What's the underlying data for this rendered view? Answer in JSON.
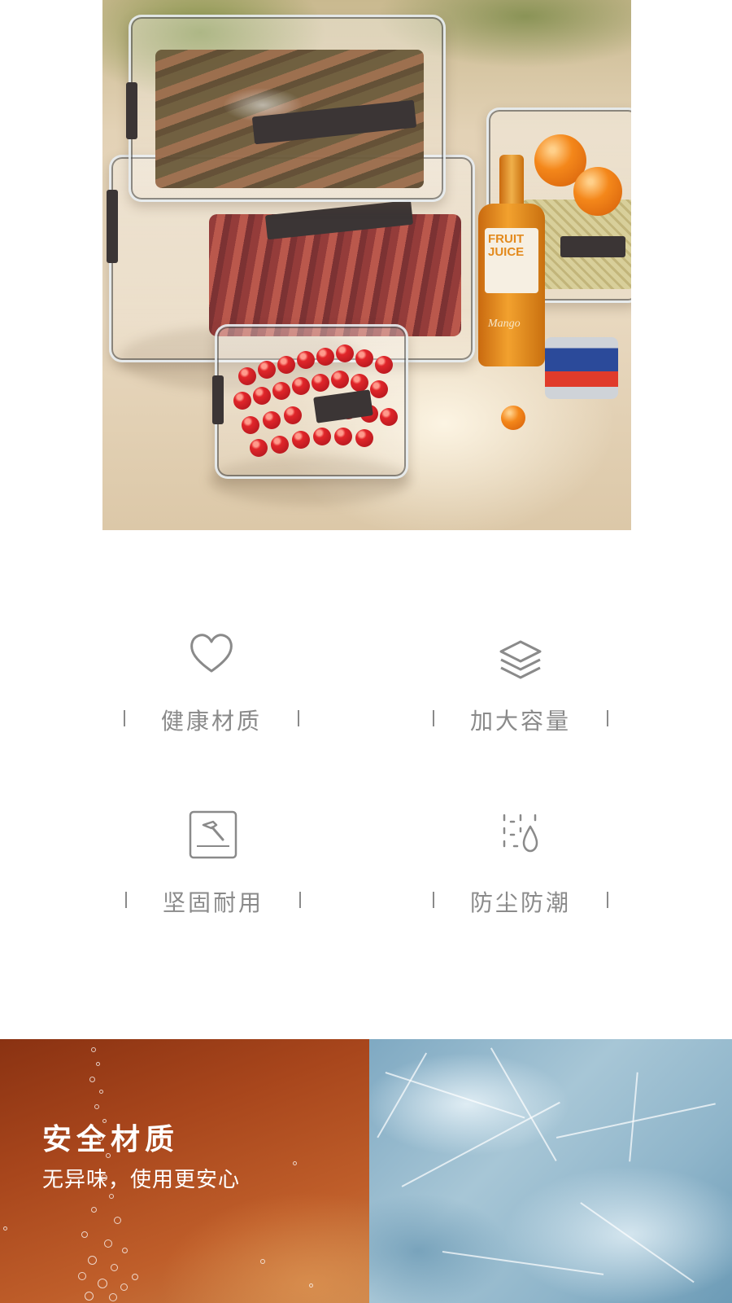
{
  "features": [
    {
      "label": "健康材质",
      "icon": "heart-icon"
    },
    {
      "label": "加大容量",
      "icon": "layers-icon"
    },
    {
      "label": "坚固耐用",
      "icon": "hammer-icon"
    },
    {
      "label": "防尘防潮",
      "icon": "droplet-dust-icon"
    }
  ],
  "hero": {
    "bottle_label": "FRUIT JUICE",
    "bottle_flavor": "Mango"
  },
  "banner": {
    "title": "安全材质",
    "subtitle": "无异味，使用更安心"
  },
  "colors": {
    "feature_text": "#8a8a8a",
    "banner_warm": "#a8461c",
    "banner_ice": "#8fb5ca"
  }
}
